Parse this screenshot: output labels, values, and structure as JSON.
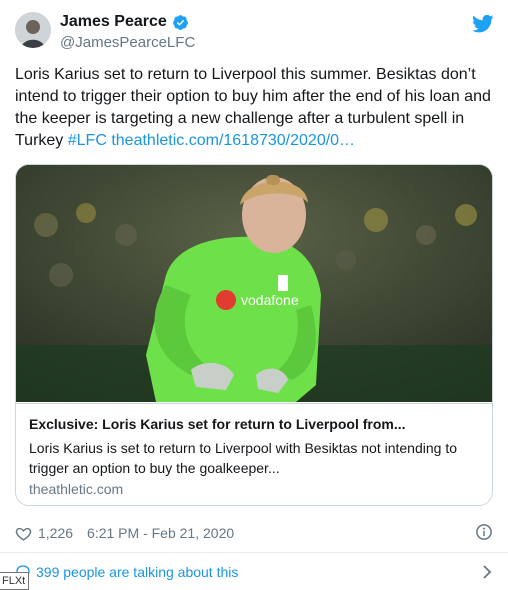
{
  "author": {
    "display_name": "James Pearce",
    "handle": "@JamesPearceLFC"
  },
  "tweet": {
    "text": "Loris Karius set to return to Liverpool this summer. Besiktas don’t intend to trigger their option to buy him after the end of his loan and the keeper is targeting a new challenge after a turbulent spell in Turkey ",
    "hashtag": "#LFC",
    "link": "theathletic.com/1618730/2020/0…"
  },
  "card": {
    "title": "Exclusive: Loris Karius set for return to Liverpool from...",
    "description": "Loris Karius is set to return to Liverpool with Besiktas not intending to trigger an option to buy the goalkeeper...",
    "domain": "theathletic.com",
    "image_description_icon": "photo-goalkeeper-image"
  },
  "meta": {
    "likes": "1,226",
    "timestamp": "6:21 PM - Feb 21, 2020"
  },
  "footer": {
    "talking": "399 people are talking about this"
  },
  "tooltip": {
    "text": "FLXt"
  },
  "colors": {
    "link": "#1b95e0",
    "secondary_text": "#657786",
    "border": "#ccd6dd",
    "jersey_green": "#6ee04a"
  },
  "icons": [
    "verified-icon",
    "twitter-bird-icon",
    "heart-icon",
    "info-icon",
    "speech-bubble-icon",
    "chevron-right-icon"
  ]
}
